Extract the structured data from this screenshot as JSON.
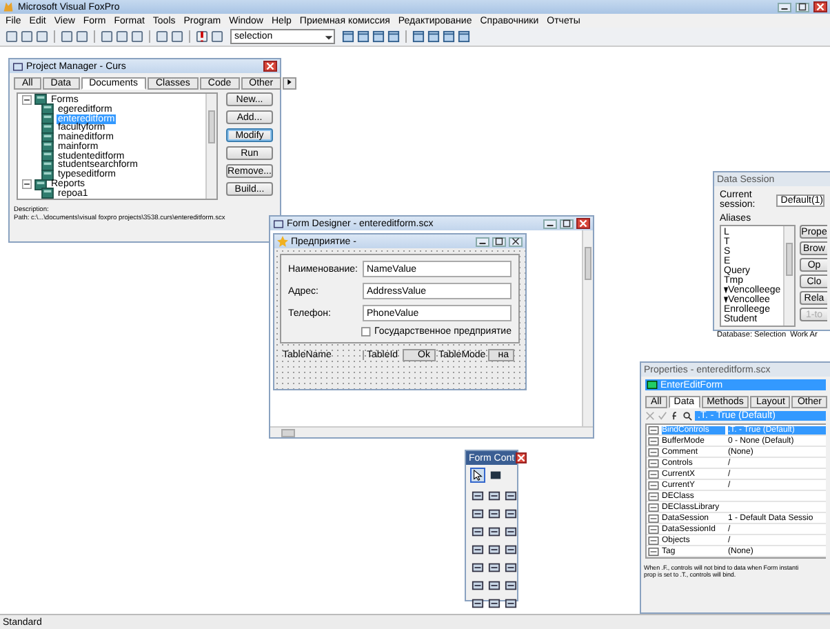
{
  "window": {
    "title": "Microsoft Visual FoxPro"
  },
  "menu": [
    "File",
    "Edit",
    "View",
    "Form",
    "Format",
    "Tools",
    "Program",
    "Window",
    "Help",
    "Приемная комиссия",
    "Редактирование",
    "Справочники",
    "Отчеты"
  ],
  "toolbar": {
    "combo_value": "selection"
  },
  "project_manager": {
    "title": "Project Manager - Curs",
    "tabs": [
      {
        "label": "All",
        "selected": false
      },
      {
        "label": "Data",
        "selected": false
      },
      {
        "label": "Documents",
        "selected": true
      },
      {
        "label": "Classes",
        "selected": false
      },
      {
        "label": "Code",
        "selected": false
      },
      {
        "label": "Other",
        "selected": false
      }
    ],
    "tree": [
      {
        "label": "Forms",
        "expanded": true,
        "selected": false,
        "children": [
          {
            "label": "egereditform",
            "selected": false
          },
          {
            "label": "entereditform",
            "selected": true
          },
          {
            "label": "facultyform",
            "selected": false
          },
          {
            "label": "maineditform",
            "selected": false
          },
          {
            "label": "mainform",
            "selected": false
          },
          {
            "label": "studenteditform",
            "selected": false
          },
          {
            "label": "studentsearchform",
            "selected": false
          },
          {
            "label": "typeseditform",
            "selected": false
          }
        ]
      },
      {
        "label": "Reports",
        "expanded": true,
        "selected": false,
        "children": [
          {
            "label": "repoa1",
            "selected": false
          }
        ]
      }
    ],
    "buttons": [
      {
        "label": "New...",
        "focused": false
      },
      {
        "label": "Add...",
        "focused": false
      },
      {
        "label": "Modify",
        "focused": true
      },
      {
        "label": "Run",
        "focused": false
      },
      {
        "label": "Remove...",
        "focused": false
      },
      {
        "label": "Build...",
        "focused": false
      }
    ],
    "description_label": "Description:",
    "path": "Path: c:\\...\\documents\\visual foxpro projects\\3538.curs\\entereditform.scx"
  },
  "form_designer": {
    "title": "Form Designer - entereditform.scx",
    "form": {
      "title": "Предприятие -",
      "fields": [
        {
          "label": "Наименование:",
          "value": "NameValue"
        },
        {
          "label": "Адрес:",
          "value": "AddressValue"
        },
        {
          "label": "Телефон:",
          "value": "PhoneValue"
        }
      ],
      "checkbox": {
        "label": "Государственное предприятие",
        "checked": false
      },
      "bottom_row": [
        "TableName",
        "TableId",
        "Ok",
        "TableMode",
        "на"
      ]
    }
  },
  "data_session": {
    "title": "Data Session",
    "session_label": "Current session:",
    "session_value": "Default(1)",
    "aliases_label": "Aliases",
    "aliases": [
      {
        "label": "L",
        "marked": false
      },
      {
        "label": "T",
        "marked": false
      },
      {
        "label": "S",
        "marked": false
      },
      {
        "label": "E",
        "marked": false
      },
      {
        "label": "Query",
        "marked": false
      },
      {
        "label": "Tmp",
        "marked": false
      },
      {
        "label": "Vencolleege",
        "marked": true
      },
      {
        "label": "Vencollee",
        "marked": true
      },
      {
        "label": "Enrolleege",
        "marked": false
      },
      {
        "label": "Student",
        "marked": false
      }
    ],
    "buttons": [
      {
        "label": "Prope",
        "disabled": false
      },
      {
        "label": "Brow",
        "disabled": false
      },
      {
        "label": "Op",
        "disabled": false
      },
      {
        "label": "Clo",
        "disabled": false
      },
      {
        "label": "Rela",
        "disabled": false
      },
      {
        "label": "1-to",
        "disabled": true
      }
    ],
    "status_left": "Database: Selection",
    "status_right": "Work Ar"
  },
  "properties": {
    "title": "Properties - entereditform.scx",
    "object": "EnterEditForm",
    "tabs": [
      {
        "label": "All",
        "selected": false
      },
      {
        "label": "Data",
        "selected": true
      },
      {
        "label": "Methods",
        "selected": false
      },
      {
        "label": "Layout",
        "selected": false
      },
      {
        "label": "Other",
        "selected": false
      }
    ],
    "value_field": ".T. - True (Default)",
    "rows": [
      {
        "name": "BindControls",
        "value": ".T. - True (Default)",
        "selected": true
      },
      {
        "name": "BufferMode",
        "value": "0 - None (Default)",
        "selected": false
      },
      {
        "name": "Comment",
        "value": "(None)",
        "selected": false
      },
      {
        "name": "Controls",
        "value": "/",
        "selected": false
      },
      {
        "name": "CurrentX",
        "value": "/",
        "selected": false
      },
      {
        "name": "CurrentY",
        "value": "/",
        "selected": false
      },
      {
        "name": "DEClass",
        "selected": false
      },
      {
        "name": "DEClassLibrary",
        "selected": false
      },
      {
        "name": "DataSession",
        "value": "1 - Default Data Sessio",
        "selected": false
      },
      {
        "name": "DataSessionId",
        "value": "/",
        "selected": false
      },
      {
        "name": "Objects",
        "value": "/",
        "selected": false
      },
      {
        "name": "Tag",
        "value": "(None)",
        "selected": false
      }
    ],
    "description": [
      "When .F., controls will not bind to data when Form instanti",
      "prop is set to .T., controls will bind."
    ]
  },
  "form_controls": {
    "title": "Form Cont"
  },
  "status_bar": "Standard"
}
